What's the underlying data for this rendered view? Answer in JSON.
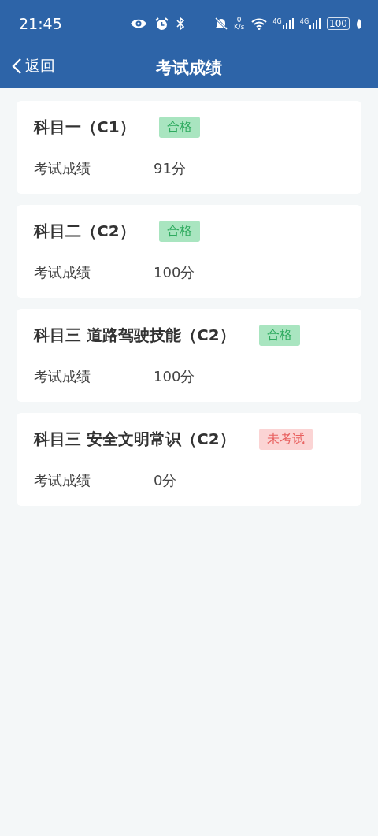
{
  "status_bar": {
    "time": "21:45",
    "net_speed_value": "0",
    "net_speed_unit": "K/s",
    "signals": [
      "4G",
      "4G"
    ],
    "battery": "100"
  },
  "nav": {
    "back": "返回",
    "title": "考试成绩"
  },
  "results": [
    {
      "subject": "科目一（C1）",
      "badge": {
        "label": "合格",
        "kind": "pass"
      },
      "label": "考试成绩",
      "score": "91分"
    },
    {
      "subject": "科目二（C2）",
      "badge": {
        "label": "合格",
        "kind": "pass"
      },
      "label": "考试成绩",
      "score": "100分"
    },
    {
      "subject": "科目三 道路驾驶技能（C2）",
      "badge": {
        "label": "合格",
        "kind": "pass"
      },
      "label": "考试成绩",
      "score": "100分"
    },
    {
      "subject": "科目三 安全文明常识（C2）",
      "badge": {
        "label": "未考试",
        "kind": "untested"
      },
      "label": "考试成绩",
      "score": "0分"
    }
  ]
}
